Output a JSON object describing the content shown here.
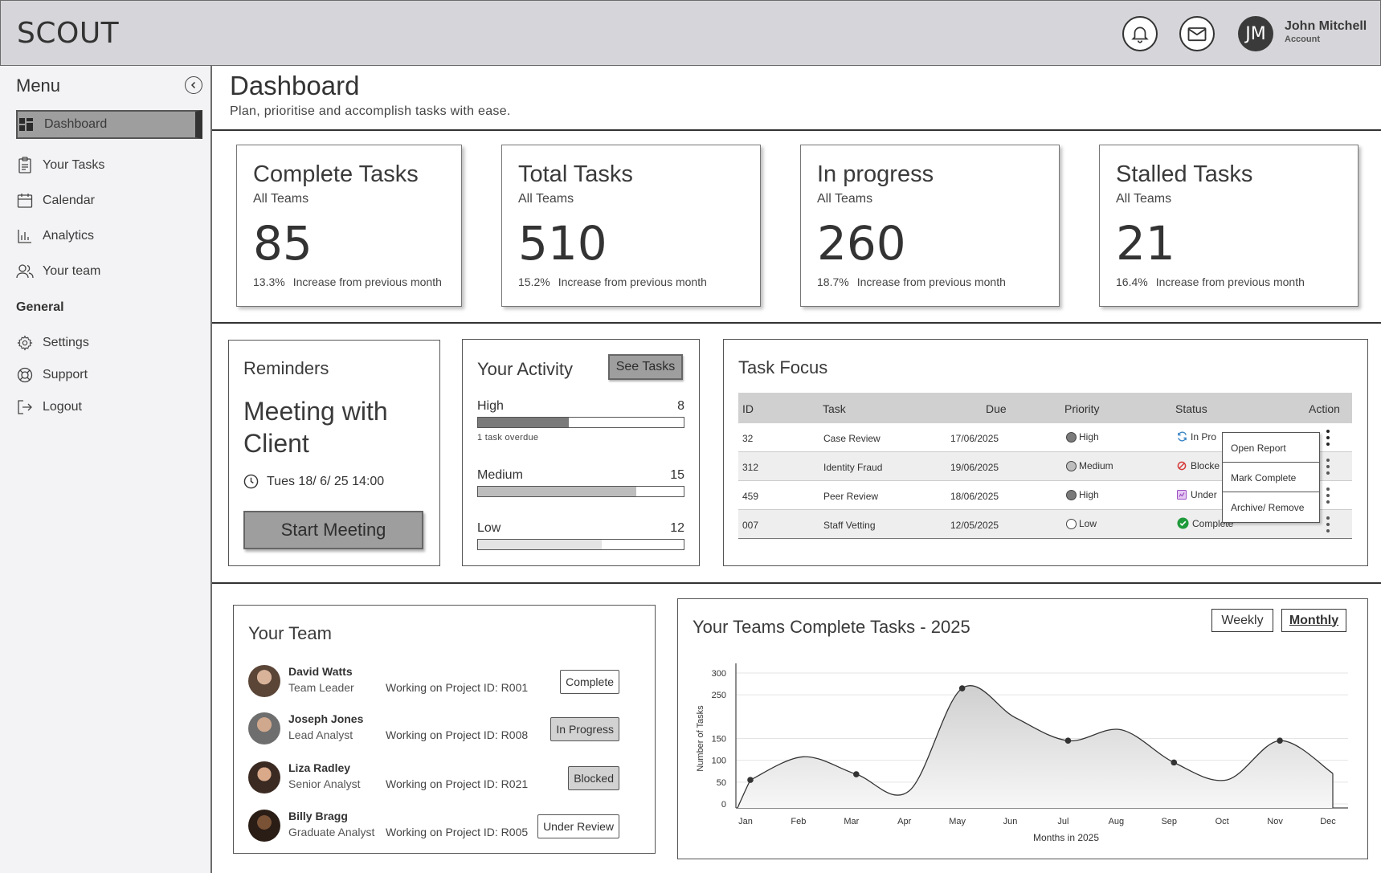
{
  "header": {
    "logo": "SCOUT",
    "user": {
      "initials": "JM",
      "name": "John Mitchell",
      "subtitle": "Account"
    },
    "icons": [
      "bell-icon",
      "mail-icon"
    ]
  },
  "sidebar": {
    "title": "Menu",
    "items": [
      {
        "label": "Dashboard",
        "icon": "dashboard-icon",
        "active": true
      },
      {
        "label": "Your Tasks",
        "icon": "clipboard-icon"
      },
      {
        "label": "Calendar",
        "icon": "calendar-icon"
      },
      {
        "label": "Analytics",
        "icon": "bar-chart-icon"
      },
      {
        "label": "Your team",
        "icon": "users-icon"
      }
    ],
    "general_label": "General",
    "general_items": [
      {
        "label": "Settings",
        "icon": "gear-icon"
      },
      {
        "label": "Support",
        "icon": "lifebuoy-icon"
      },
      {
        "label": "Logout",
        "icon": "logout-icon"
      }
    ]
  },
  "page": {
    "title": "Dashboard",
    "subtitle": "Plan, prioritise and accomplish tasks with ease."
  },
  "stats": [
    {
      "title": "Complete Tasks",
      "sub": "All Teams",
      "value": "85",
      "pct": "13.3%",
      "note": "Increase from previous month"
    },
    {
      "title": "Total Tasks",
      "sub": "All Teams",
      "value": "510",
      "pct": "15.2%",
      "note": "Increase from previous month"
    },
    {
      "title": "In progress",
      "sub": "All Teams",
      "value": "260",
      "pct": "18.7%",
      "note": "Increase from previous month"
    },
    {
      "title": "Stalled Tasks",
      "sub": "All Teams",
      "value": "21",
      "pct": "16.4%",
      "note": "Increase from previous month"
    }
  ],
  "reminders": {
    "title": "Reminders",
    "meeting": "Meeting with Client",
    "time": "Tues 18/ 6/ 25 14:00",
    "button": "Start Meeting"
  },
  "activity": {
    "title": "Your Activity",
    "button": "See Tasks",
    "rows": [
      {
        "label": "High",
        "count": "8",
        "fill": 0.44,
        "note": "1 task overdue"
      },
      {
        "label": "Medium",
        "count": "15",
        "fill": 0.77,
        "note": ""
      },
      {
        "label": "Low",
        "count": "12",
        "fill": 0.6,
        "note": ""
      }
    ]
  },
  "task_focus": {
    "title": "Task Focus",
    "columns": [
      "ID",
      "Task",
      "Due",
      "Priority",
      "Status",
      "Action"
    ],
    "rows": [
      {
        "id": "32",
        "task": "Case Review",
        "due": "17/06/2025",
        "priority": "High",
        "status": "In Pro",
        "status_icon": "refresh-icon"
      },
      {
        "id": "312",
        "task": "Identity Fraud",
        "due": "19/06/2025",
        "priority": "Medium",
        "status": "Blocke",
        "status_icon": "blocked-icon"
      },
      {
        "id": "459",
        "task": "Peer Review",
        "due": "18/06/2025",
        "priority": "High",
        "status": "Under",
        "status_icon": "review-icon"
      },
      {
        "id": "007",
        "task": "Staff Vetting",
        "due": "12/05/2025",
        "priority": "Low",
        "status": "Complete",
        "status_icon": "check-circle-icon"
      }
    ],
    "context_menu": [
      "Open Report",
      "Mark Complete",
      "Archive/ Remove"
    ]
  },
  "team": {
    "title": "Your Team",
    "members": [
      {
        "name": "David Watts",
        "role": "Team Leader",
        "project": "Working on Project ID: R001",
        "status": "Complete"
      },
      {
        "name": "Joseph Jones",
        "role": "Lead Analyst",
        "project": "Working on Project ID: R008",
        "status": "In Progress"
      },
      {
        "name": "Liza Radley",
        "role": "Senior Analyst",
        "project": "Working on Project ID: R021",
        "status": "Blocked"
      },
      {
        "name": "Billy Bragg",
        "role": "Graduate Analyst",
        "project": "Working on Project ID: R005",
        "status": "Under Review"
      }
    ]
  },
  "chart_data": {
    "type": "area",
    "title": "Your Teams Complete Tasks - 2025",
    "toggles": [
      "Weekly",
      "Monthly"
    ],
    "active_toggle": "Monthly",
    "categories": [
      "Jan",
      "Feb",
      "Mar",
      "Apr",
      "May",
      "Jun",
      "Jul",
      "Aug",
      "Sep",
      "Oct",
      "Nov",
      "Dec"
    ],
    "values": [
      55,
      108,
      68,
      30,
      265,
      198,
      145,
      170,
      95,
      55,
      145,
      70
    ],
    "markers": [
      0,
      2,
      4,
      6,
      8,
      10
    ],
    "xlabel": "Months in 2025",
    "ylabel": "Number of Tasks",
    "yticks": [
      0,
      50,
      100,
      150,
      250,
      300
    ],
    "ylim": [
      0,
      300
    ],
    "grid": true,
    "legend": "none"
  }
}
